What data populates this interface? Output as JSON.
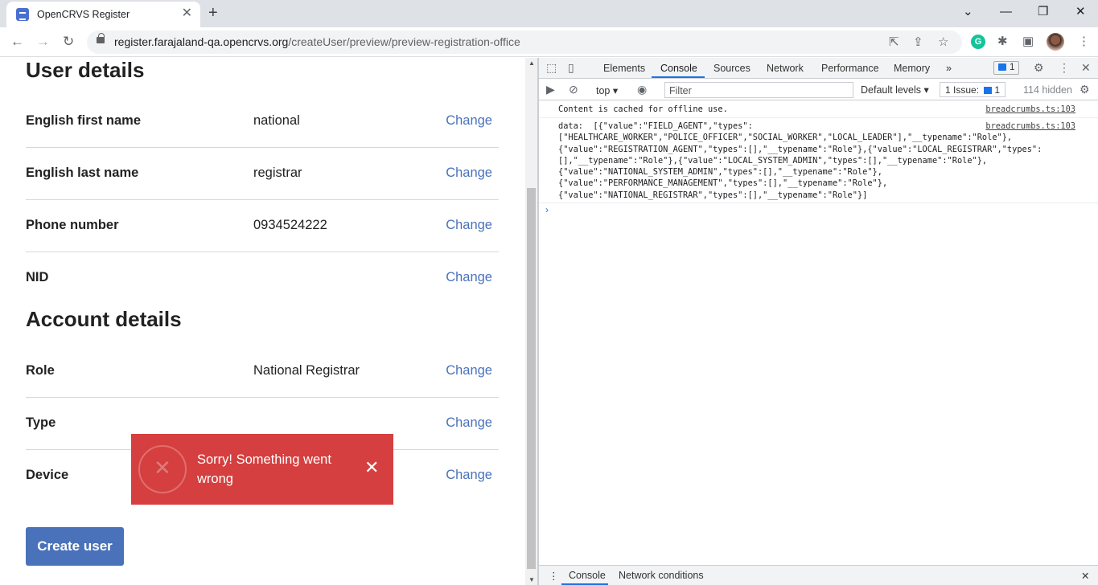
{
  "browser": {
    "tab_title": "OpenCRVS Register",
    "tab_close": "✕",
    "new_tab": "+",
    "window_controls": [
      "⌄",
      "—",
      "❐",
      "✕"
    ],
    "url_host": "register.farajaland-qa.opencrvs.org",
    "url_path": "/createUser/preview/preview-registration-office",
    "grammarly": "G"
  },
  "page": {
    "user_section_title": "User details",
    "user_rows": [
      {
        "label": "English first name",
        "value": "national",
        "action": "Change"
      },
      {
        "label": "English last name",
        "value": "registrar",
        "action": "Change"
      },
      {
        "label": "Phone number",
        "value": "0934524222",
        "action": "Change"
      },
      {
        "label": "NID",
        "value": "",
        "action": "Change"
      }
    ],
    "account_section_title": "Account details",
    "account_rows": [
      {
        "label": "Role",
        "value": "National Registrar",
        "action": "Change"
      },
      {
        "label": "Type",
        "value": "",
        "action": "Change"
      },
      {
        "label": "Device",
        "value": "",
        "action": "Change"
      }
    ],
    "create_button": "Create user",
    "toast": {
      "message": "Sorry! Something went wrong",
      "close": "✕",
      "color": "#d53f3f"
    },
    "accent_color": "#4972bb"
  },
  "devtools": {
    "tabs": [
      "Elements",
      "Console",
      "Sources",
      "Network",
      "Performance",
      "Memory"
    ],
    "active_tab": "Console",
    "more_tabs": "»",
    "message_badge_count": "1",
    "context": "top ▾",
    "filter_placeholder": "Filter",
    "levels": "Default levels ▾",
    "issues_label": "1 Issue:",
    "issues_count": "1",
    "hidden": "114 hidden",
    "logs": [
      {
        "text": "Content is cached for offline use.",
        "source": "breadcrumbs.ts:103"
      },
      {
        "text": "data:  [{\"value\":\"FIELD_AGENT\",\"types\":\n[\"HEALTHCARE_WORKER\",\"POLICE_OFFICER\",\"SOCIAL_WORKER\",\"LOCAL_LEADER\"],\"__typename\":\"Role\"},\n{\"value\":\"REGISTRATION_AGENT\",\"types\":[],\"__typename\":\"Role\"},{\"value\":\"LOCAL_REGISTRAR\",\"types\":\n[],\"__typename\":\"Role\"},{\"value\":\"LOCAL_SYSTEM_ADMIN\",\"types\":[],\"__typename\":\"Role\"},\n{\"value\":\"NATIONAL_SYSTEM_ADMIN\",\"types\":[],\"__typename\":\"Role\"},\n{\"value\":\"PERFORMANCE_MANAGEMENT\",\"types\":[],\"__typename\":\"Role\"},\n{\"value\":\"NATIONAL_REGISTRAR\",\"types\":[],\"__typename\":\"Role\"}]",
        "source": "breadcrumbs.ts:103"
      }
    ],
    "prompt": "›",
    "drawer_tabs": [
      "Console",
      "Network conditions"
    ],
    "drawer_close": "✕"
  }
}
